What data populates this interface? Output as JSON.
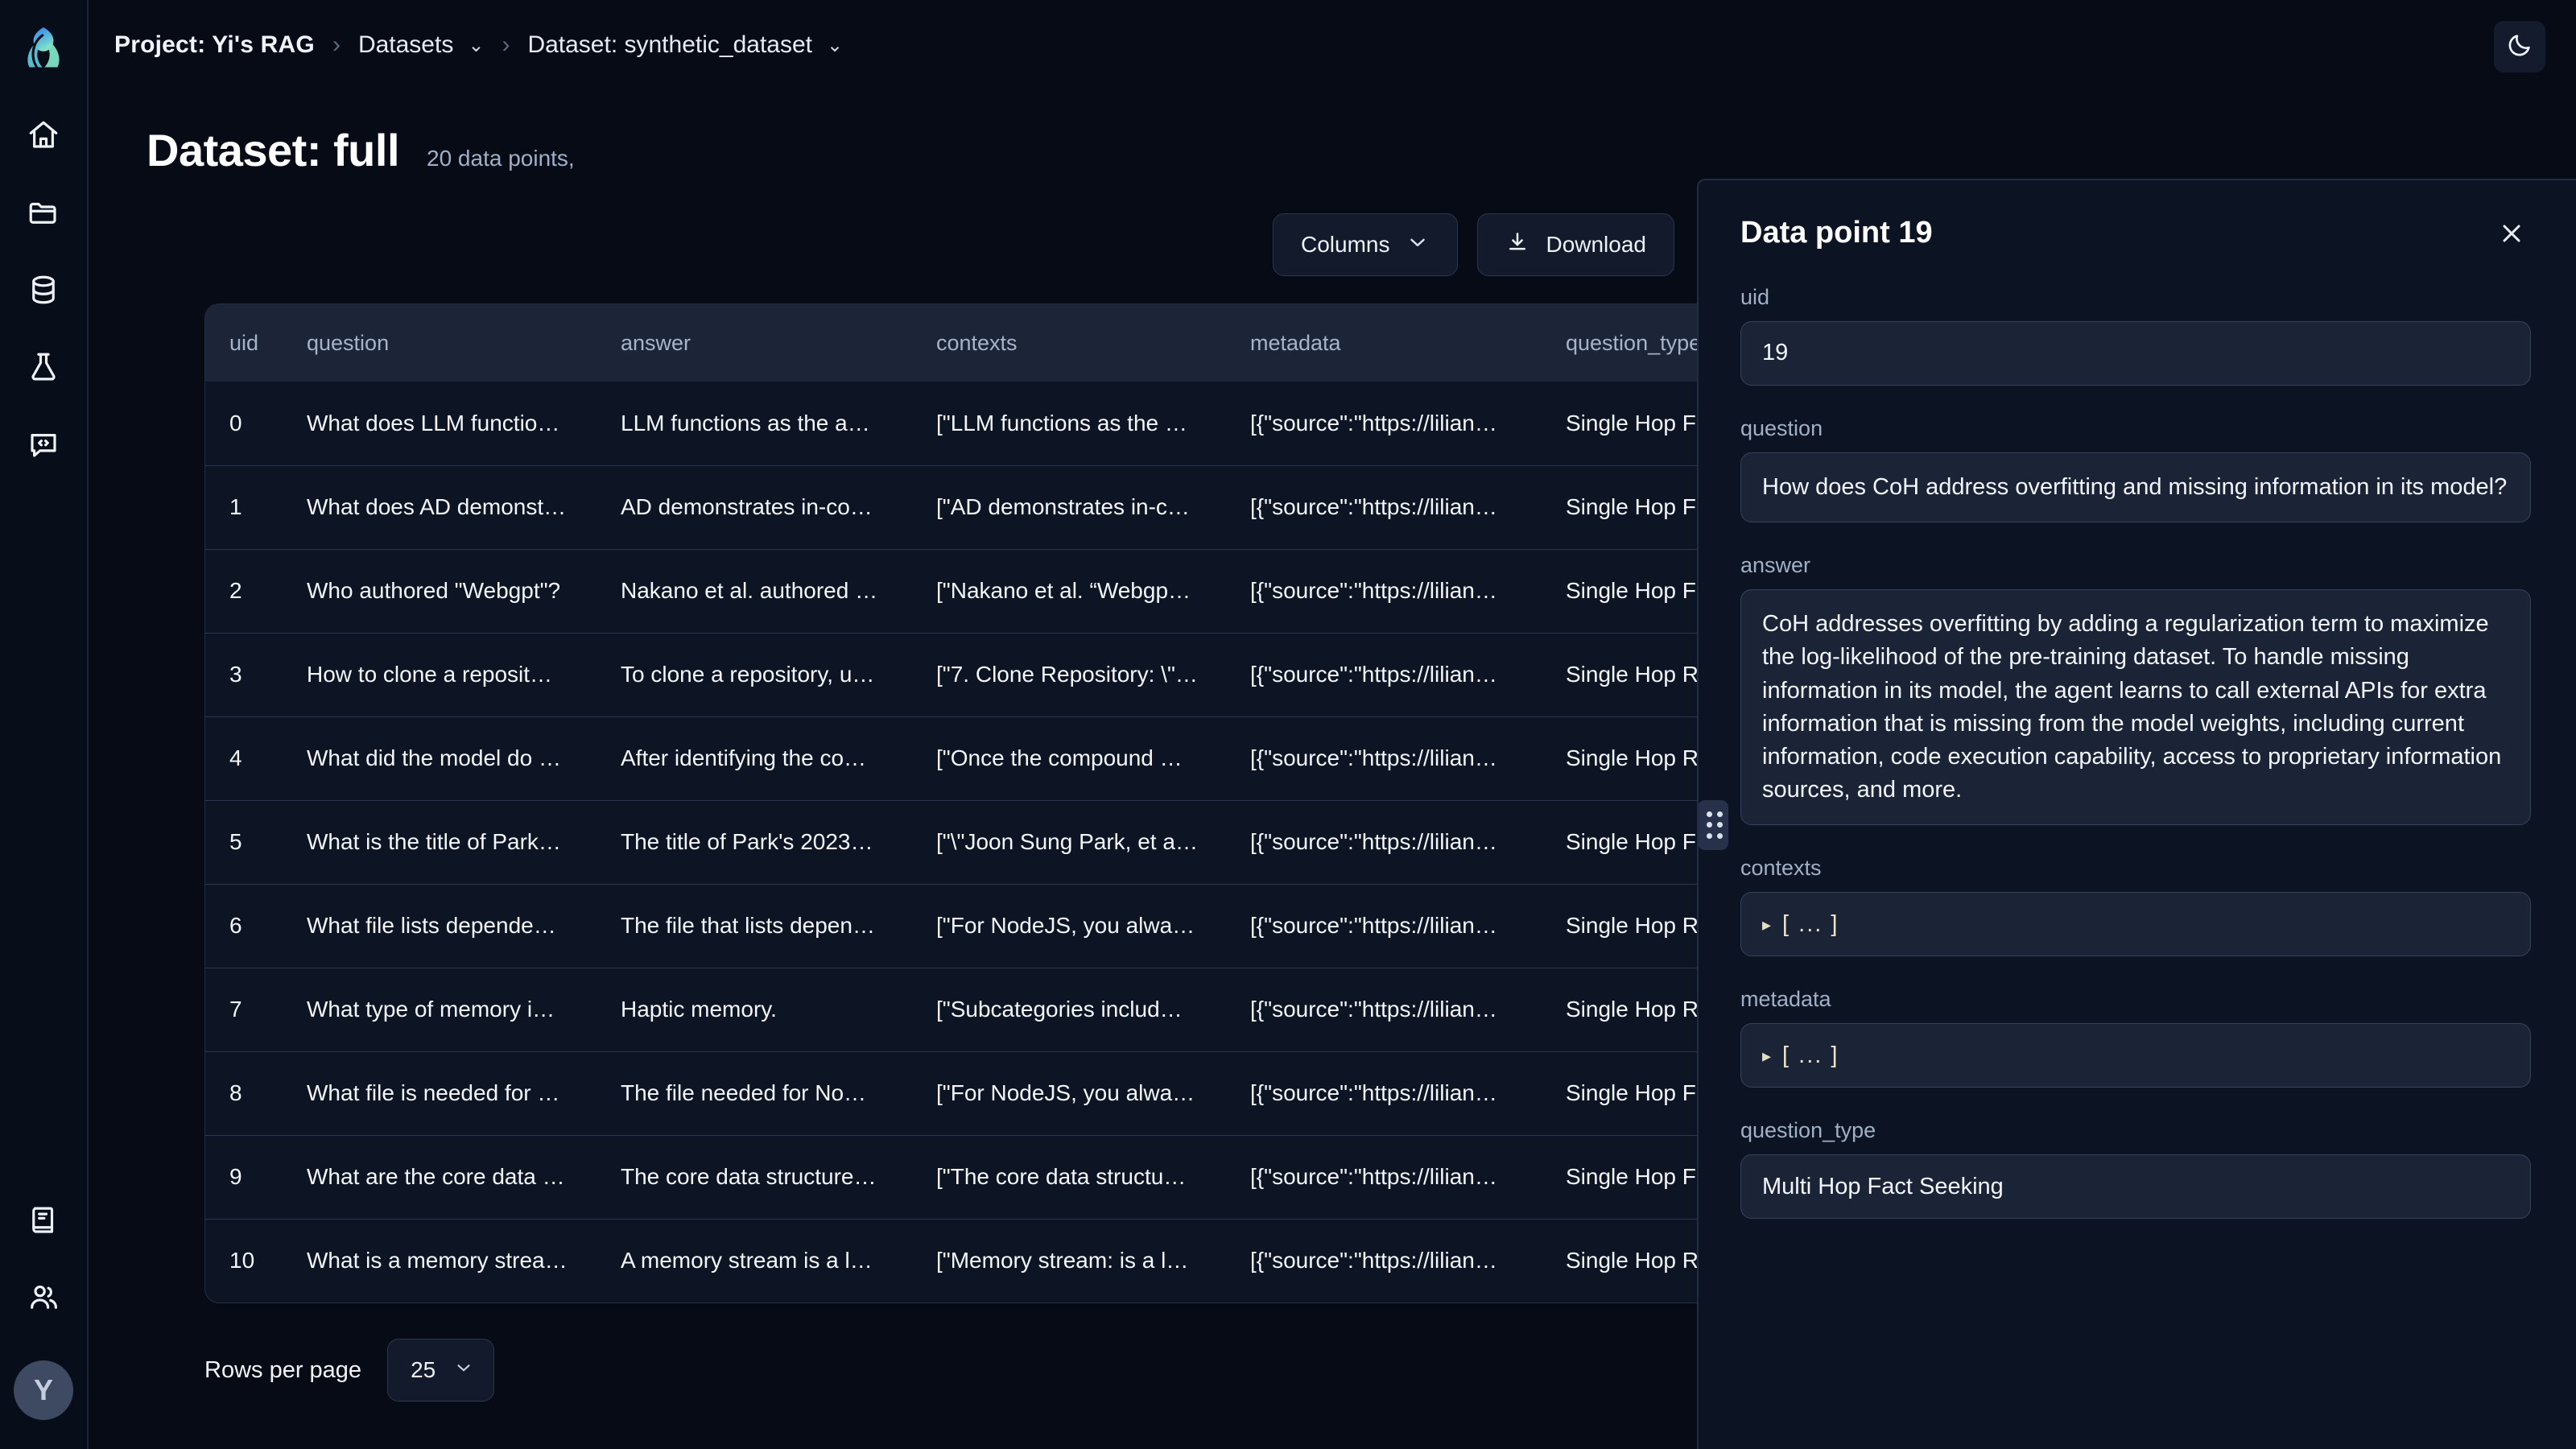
{
  "app": {
    "logo_icon": "droplet-leaf-logo",
    "theme_toggle_icon": "moon-icon"
  },
  "sidebar": {
    "items": [
      {
        "icon": "home-icon",
        "name": "home"
      },
      {
        "icon": "folder-icon",
        "name": "projects"
      },
      {
        "icon": "database-icon",
        "name": "datasets"
      },
      {
        "icon": "flask-icon",
        "name": "experiments"
      },
      {
        "icon": "comment-code-icon",
        "name": "prompts"
      }
    ],
    "bottom_items": [
      {
        "icon": "book-icon",
        "name": "docs"
      },
      {
        "icon": "users-icon",
        "name": "members"
      }
    ],
    "avatar_initial": "Y"
  },
  "breadcrumb": {
    "project": "Project: Yi's RAG",
    "sep": "›",
    "datasets": "Datasets",
    "dataset": "Dataset: synthetic_dataset",
    "caret": "⌄"
  },
  "page": {
    "title": "Dataset: full",
    "subtitle": "20 data points,"
  },
  "toolbar": {
    "columns_label": "Columns",
    "columns_caret": "⌄",
    "download_label": "Download",
    "download_icon": "download-icon"
  },
  "table": {
    "columns": [
      "uid",
      "question",
      "answer",
      "contexts",
      "metadata",
      "question_type"
    ],
    "rows": [
      {
        "uid": "0",
        "question": "What does LLM functio…",
        "answer": "LLM functions as the a…",
        "contexts": "[\"LLM functions as the …",
        "metadata": "[{\"source\":\"https://lilian…",
        "question_type": "Single Hop Fact"
      },
      {
        "uid": "1",
        "question": "What does AD demonst…",
        "answer": "AD demonstrates in-co…",
        "contexts": "[\"AD demonstrates in-c…",
        "metadata": "[{\"source\":\"https://lilian…",
        "question_type": "Single Hop Fact"
      },
      {
        "uid": "2",
        "question": "Who authored \"Webgpt\"?",
        "answer": "Nakano et al. authored …",
        "contexts": "[\"Nakano et al. “Webgp…",
        "metadata": "[{\"source\":\"https://lilian…",
        "question_type": "Single Hop Fact"
      },
      {
        "uid": "3",
        "question": "How to clone a reposit…",
        "answer": "To clone a repository, u…",
        "contexts": "[\"7. Clone Repository: \\\"…",
        "metadata": "[{\"source\":\"https://lilian…",
        "question_type": "Single Hop Reas"
      },
      {
        "uid": "4",
        "question": "What did the model do …",
        "answer": "After identifying the co…",
        "contexts": "[\"Once the compound …",
        "metadata": "[{\"source\":\"https://lilian…",
        "question_type": "Single Hop Reas"
      },
      {
        "uid": "5",
        "question": "What is the title of Park…",
        "answer": "The title of Park's 2023…",
        "contexts": "[\"\\\"Joon Sung Park, et a…",
        "metadata": "[{\"source\":\"https://lilian…",
        "question_type": "Single Hop Fact"
      },
      {
        "uid": "6",
        "question": "What file lists depende…",
        "answer": "The file that lists depen…",
        "contexts": "[\"For NodeJS, you alwa…",
        "metadata": "[{\"source\":\"https://lilian…",
        "question_type": "Single Hop Reas"
      },
      {
        "uid": "7",
        "question": "What type of memory i…",
        "answer": "Haptic memory.",
        "contexts": "[\"Subcategories includ…",
        "metadata": "[{\"source\":\"https://lilian…",
        "question_type": "Single Hop Reas"
      },
      {
        "uid": "8",
        "question": "What file is needed for …",
        "answer": "The file needed for No…",
        "contexts": "[\"For NodeJS, you alwa…",
        "metadata": "[{\"source\":\"https://lilian…",
        "question_type": "Single Hop Fact"
      },
      {
        "uid": "9",
        "question": "What are the core data …",
        "answer": "The core data structure…",
        "contexts": "[\"The core data structu…",
        "metadata": "[{\"source\":\"https://lilian…",
        "question_type": "Single Hop Fact"
      },
      {
        "uid": "10",
        "question": "What is a memory strea…",
        "answer": "A memory stream is a l…",
        "contexts": "[\"Memory stream: is a l…",
        "metadata": "[{\"source\":\"https://lilian…",
        "question_type": "Single Hop Reas"
      }
    ]
  },
  "footer": {
    "rows_per_page_label": "Rows per page",
    "rows_per_page_value": "25",
    "caret": "⌄"
  },
  "detail": {
    "title": "Data point 19",
    "close_icon": "close-icon",
    "grip_icon": "drag-handle-icon",
    "fields": {
      "uid_label": "uid",
      "uid_value": "19",
      "question_label": "question",
      "question_value": "How does CoH address overfitting and missing information in its model?",
      "answer_label": "answer",
      "answer_value": "CoH addresses overfitting by adding a regularization term to maximize the log-likelihood of the pre-training dataset. To handle missing information in its model, the agent learns to call external APIs for extra information that is missing from the model weights, including current information, code execution capability, access to proprietary information sources, and more.",
      "contexts_label": "contexts",
      "contexts_value": "[ ... ]",
      "metadata_label": "metadata",
      "metadata_value": "[ ... ]",
      "question_type_label": "question_type",
      "question_type_value": "Multi Hop Fact Seeking",
      "collapse_triangle": "▸"
    }
  },
  "colors": {
    "page_bg": "#070b16",
    "panel_bg": "#0c1322",
    "field_bg": "#1b2437",
    "accent_logo_top": "#2f7ef5",
    "accent_logo_bottom": "#7fe3c4",
    "json_bracket": "#f0e5c8"
  }
}
